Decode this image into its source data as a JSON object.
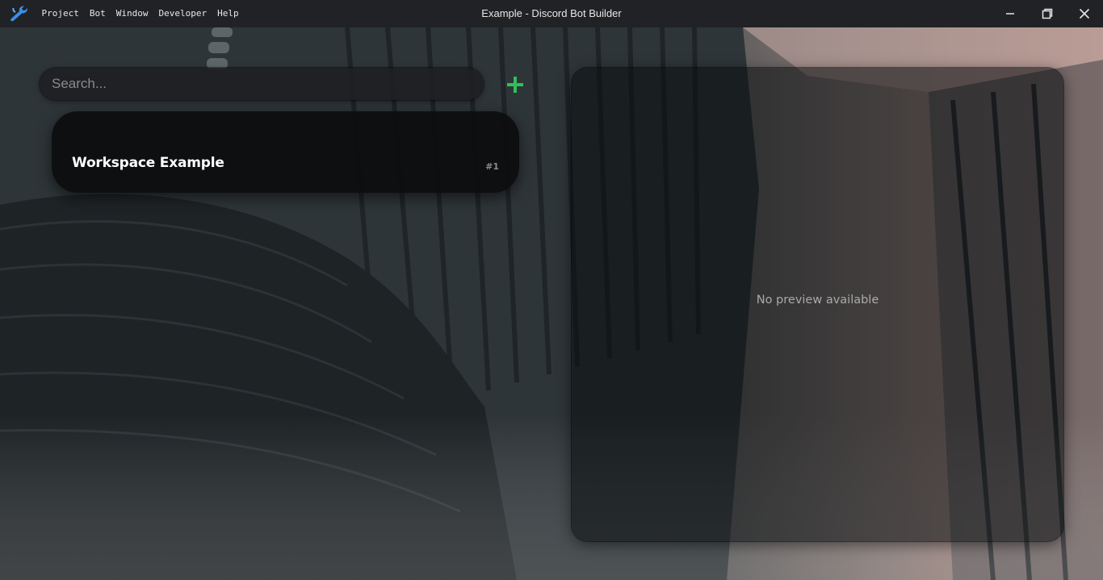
{
  "titlebar": {
    "title": "Example - Discord Bot Builder",
    "menu": [
      {
        "label": "Project"
      },
      {
        "label": "Bot"
      },
      {
        "label": "Window"
      },
      {
        "label": "Developer"
      },
      {
        "label": "Help"
      }
    ],
    "icons": [
      "wrench-logo-icon",
      "minimize-icon",
      "restore-icon",
      "close-icon"
    ]
  },
  "search": {
    "placeholder": "Search...",
    "value": ""
  },
  "add_button": {
    "icon": "plus-icon",
    "color": "#2fbf5a"
  },
  "workspaces": [
    {
      "name": "Workspace Example",
      "number": "#1"
    }
  ],
  "preview": {
    "empty_text": "No preview available"
  },
  "colors": {
    "titlebar_bg": "#202225",
    "accent_logo": "#3a8ee6",
    "card_bg": "#0e0e10"
  }
}
